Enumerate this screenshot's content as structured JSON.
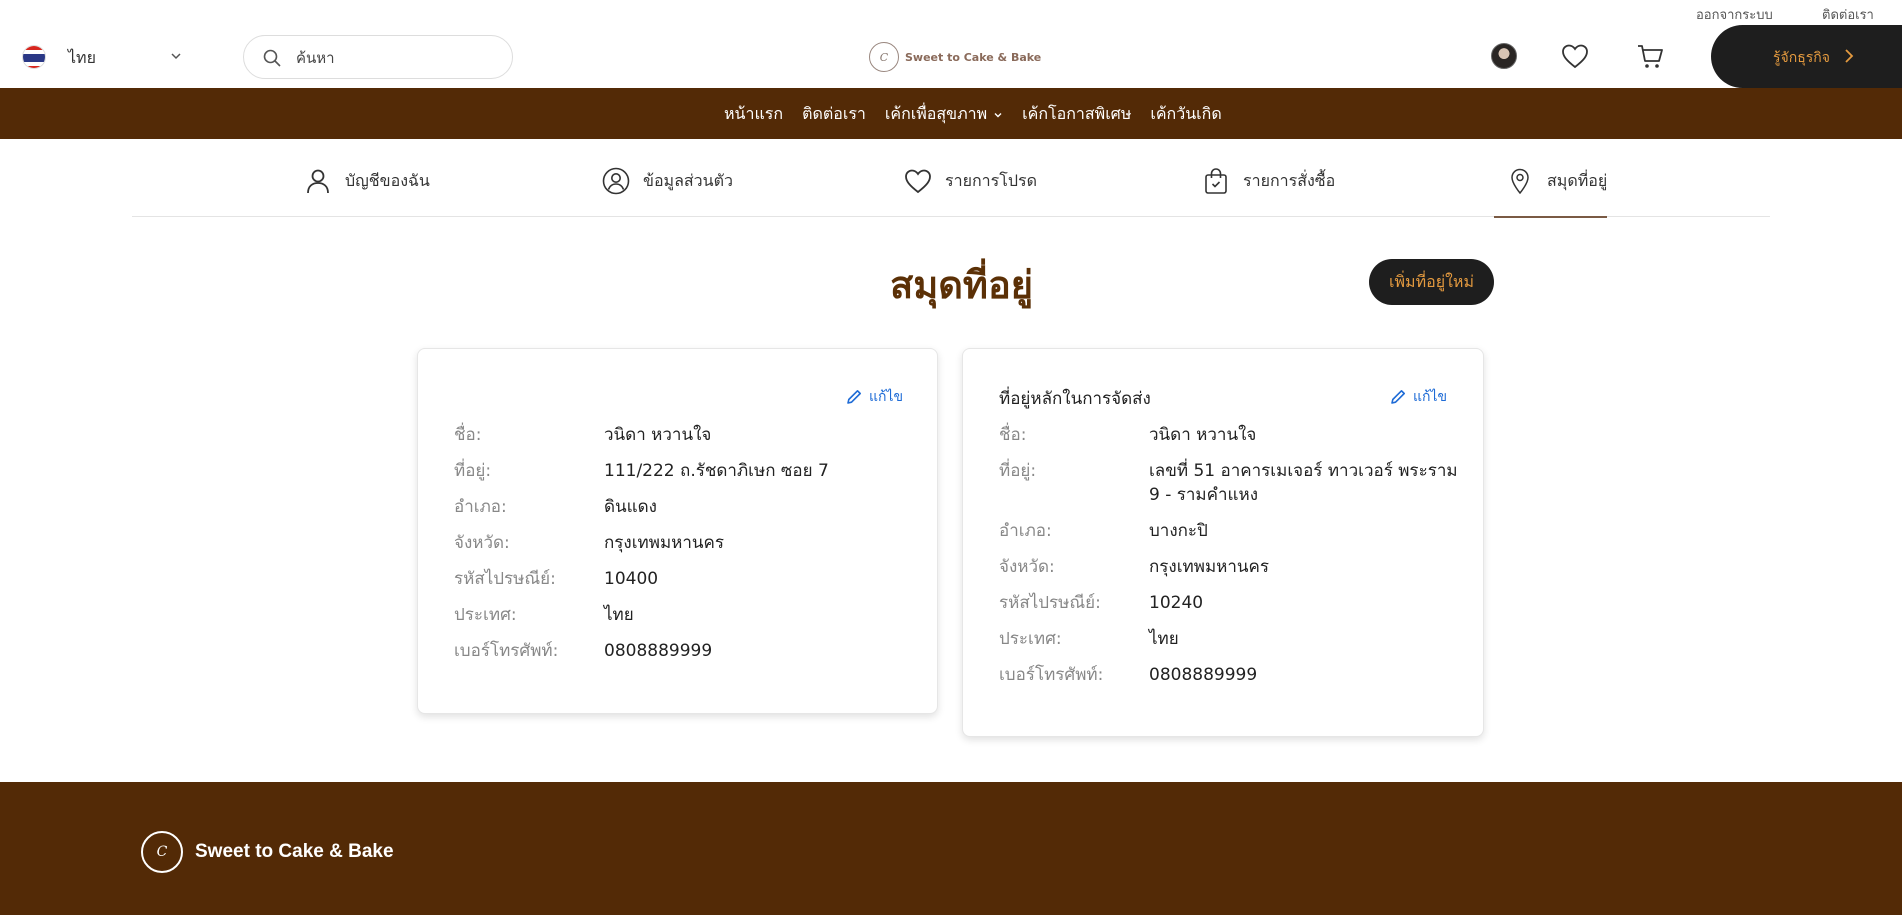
{
  "topbar": {
    "logout_label": "ออกจากระบบ",
    "contact_label": "ติดต่อเรา"
  },
  "header": {
    "language": "ไทย",
    "search_placeholder": "ค้นหา",
    "logo_text": "Sweet to Cake & Bake",
    "business_label": "รู้จักธุรกิจ"
  },
  "nav": {
    "items": [
      "หน้าแรก",
      "ติดต่อเรา",
      "เค้กเพื่อสุขภาพ",
      "เค้กโอกาสพิเศษ",
      "เค้กวันเกิด"
    ]
  },
  "tabs": [
    {
      "label": "บัญชีของฉัน",
      "icon": "user-icon"
    },
    {
      "label": "ข้อมูลส่วนตัว",
      "icon": "profile-icon"
    },
    {
      "label": "รายการโปรด",
      "icon": "heart-icon"
    },
    {
      "label": "รายการสั่งซื้อ",
      "icon": "shopping-bag-icon"
    },
    {
      "label": "สมุดที่อยู่",
      "icon": "location-pin-icon",
      "active": true
    }
  ],
  "page": {
    "title": "สมุดที่อยู่",
    "add_button": "เพิ่มที่อยู่ใหม่"
  },
  "labels": {
    "name": "ชื่อ:",
    "address": "ที่อยู่:",
    "district": "อำเภอ:",
    "province": "จังหวัด:",
    "postal": "รหัสไปรษณีย์:",
    "country": "ประเทศ:",
    "phone": "เบอร์โทรศัพท์:",
    "edit": "แก้ไข"
  },
  "addresses": [
    {
      "heading": "",
      "name": "วนิดา หวานใจ",
      "address": "111/222 ถ.รัชดาภิเษก ซอย 7",
      "district": "ดินแดง",
      "province": "กรุงเทพมหานคร",
      "postal": "10400",
      "country": "ไทย",
      "phone": "0808889999"
    },
    {
      "heading": "ที่อยู่หลักในการจัดส่ง",
      "name": "วนิดา หวานใจ",
      "address": "เลขที่ 51 อาคารเมเจอร์ ทาวเวอร์ พระราม 9 - รามคำแหง",
      "district": "บางกะปิ",
      "province": "กรุงเทพมหานคร",
      "postal": "10240",
      "country": "ไทย",
      "phone": "0808889999"
    }
  ],
  "footer": {
    "logo_text": "Sweet to Cake & Bake"
  },
  "colors": {
    "brand_brown": "#532a06",
    "accent_orange": "#e49a3f",
    "dark": "#1e1e1e",
    "link_blue": "#1e6bd6"
  }
}
